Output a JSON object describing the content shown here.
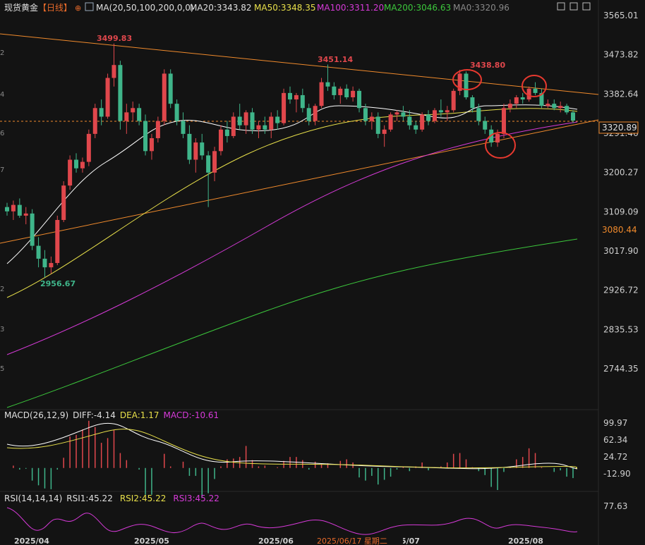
{
  "header": {
    "symbol": "现货黄金",
    "period": "【日线】",
    "ma_spec": "MA(20,50,100,200,0,0)",
    "ma20": "MA20:3343.82",
    "ma50": "MA50:3348.35",
    "ma100": "MA100:3311.20",
    "ma200": "MA200:3046.63",
    "ma0": "MA0:3320.96"
  },
  "price_axis": {
    "ticks": [
      "3565.01",
      "3473.82",
      "3382.64",
      "3291.46",
      "3200.27",
      "3109.09",
      "3017.90",
      "2926.72",
      "2835.53",
      "2744.35"
    ],
    "current_price": "3320.89",
    "ma200_tag": "3080.44"
  },
  "annotations": {
    "high1": "3499.83",
    "high2": "3451.14",
    "high3": "3438.80",
    "low1": "2956.67"
  },
  "macd": {
    "title": "MACD(26,12,9)",
    "diff": "DIFF:-4.14",
    "dea": "DEA:1.17",
    "macd": "MACD:-10.61",
    "ticks": [
      "99.97",
      "62.34",
      "24.72",
      "-12.90"
    ]
  },
  "rsi": {
    "title": "RSI(14,14,14)",
    "rsi1": "RSI1:45.22",
    "rsi2": "RSI2:45.22",
    "rsi3": "RSI3:45.22",
    "tick": "77.63"
  },
  "xaxis": {
    "labels": [
      "2025/04",
      "2025/05",
      "2025/06",
      "2025/07",
      "2025/08"
    ],
    "crosshair_date": "2025/06/17 星期二"
  },
  "colors": {
    "up": "#e0474c",
    "down": "#3fb58a",
    "ma20": "#ffffff",
    "ma50": "#e8e04a",
    "ma100": "#d63ad8",
    "ma200": "#3cc83c",
    "trendline": "#f08a2c",
    "circle": "#e8392f"
  },
  "chart_data": {
    "type": "candlestick",
    "title": "现货黄金 【日线】",
    "ylim": [
      2700,
      3580
    ],
    "x_range": [
      "2025/04",
      "2025/08"
    ],
    "indicators": [
      "MA20",
      "MA50",
      "MA100",
      "MA200",
      "MACD(26,12,9)",
      "RSI(14,14,14)"
    ],
    "ma_values": {
      "MA20": 3343.82,
      "MA50": 3348.35,
      "MA100": 3311.2,
      "MA200": 3046.63,
      "MA0": 3320.96
    },
    "marked_values": {
      "high_apr": 3499.83,
      "high_jun": 3451.14,
      "high_jul": 3438.8,
      "low_apr": 2956.67,
      "last": 3320.89
    },
    "macd_values": {
      "DIFF": -4.14,
      "DEA": 1.17,
      "MACD": -10.61
    },
    "rsi_values": {
      "RSI1": 45.22,
      "RSI2": 45.22,
      "RSI3": 45.22
    },
    "candles": [
      [
        3120,
        3130,
        3100,
        3110
      ],
      [
        3110,
        3135,
        3090,
        3125
      ],
      [
        3125,
        3140,
        3095,
        3100
      ],
      [
        3100,
        3120,
        3080,
        3105
      ],
      [
        3105,
        3115,
        3020,
        3030
      ],
      [
        3030,
        3050,
        2980,
        3000
      ],
      [
        3000,
        3020,
        2956.67,
        2980
      ],
      [
        2980,
        3005,
        2965,
        2990
      ],
      [
        2990,
        3100,
        2985,
        3090
      ],
      [
        3090,
        3180,
        3085,
        3170
      ],
      [
        3170,
        3240,
        3160,
        3230
      ],
      [
        3230,
        3245,
        3200,
        3210
      ],
      [
        3210,
        3235,
        3200,
        3225
      ],
      [
        3225,
        3300,
        3215,
        3290
      ],
      [
        3290,
        3360,
        3280,
        3350
      ],
      [
        3350,
        3370,
        3310,
        3330
      ],
      [
        3330,
        3430,
        3325,
        3420
      ],
      [
        3420,
        3499.83,
        3400,
        3450
      ],
      [
        3450,
        3460,
        3300,
        3320
      ],
      [
        3320,
        3360,
        3290,
        3340
      ],
      [
        3340,
        3365,
        3320,
        3350
      ],
      [
        3350,
        3360,
        3310,
        3320
      ],
      [
        3320,
        3335,
        3240,
        3250
      ],
      [
        3250,
        3290,
        3230,
        3280
      ],
      [
        3280,
        3330,
        3270,
        3320
      ],
      [
        3320,
        3440,
        3310,
        3430
      ],
      [
        3430,
        3440,
        3350,
        3360
      ],
      [
        3360,
        3370,
        3310,
        3320
      ],
      [
        3320,
        3340,
        3280,
        3290
      ],
      [
        3290,
        3310,
        3220,
        3230
      ],
      [
        3230,
        3280,
        3200,
        3270
      ],
      [
        3270,
        3290,
        3230,
        3240
      ],
      [
        3240,
        3250,
        3120,
        3200
      ],
      [
        3200,
        3260,
        3180,
        3250
      ],
      [
        3250,
        3310,
        3240,
        3300
      ],
      [
        3300,
        3320,
        3270,
        3285
      ],
      [
        3285,
        3340,
        3280,
        3330
      ],
      [
        3330,
        3360,
        3300,
        3310
      ],
      [
        3310,
        3345,
        3290,
        3340
      ],
      [
        3340,
        3350,
        3290,
        3300
      ],
      [
        3300,
        3320,
        3280,
        3310
      ],
      [
        3310,
        3330,
        3290,
        3300
      ],
      [
        3300,
        3340,
        3280,
        3330
      ],
      [
        3330,
        3345,
        3300,
        3315
      ],
      [
        3315,
        3395,
        3310,
        3385
      ],
      [
        3385,
        3400,
        3360,
        3370
      ],
      [
        3370,
        3385,
        3340,
        3380
      ],
      [
        3380,
        3395,
        3340,
        3350
      ],
      [
        3350,
        3360,
        3310,
        3320
      ],
      [
        3320,
        3360,
        3310,
        3355
      ],
      [
        3355,
        3420,
        3350,
        3410
      ],
      [
        3410,
        3451.14,
        3390,
        3400
      ],
      [
        3400,
        3410,
        3370,
        3380
      ],
      [
        3380,
        3400,
        3360,
        3395
      ],
      [
        3395,
        3405,
        3370,
        3375
      ],
      [
        3375,
        3400,
        3365,
        3390
      ],
      [
        3390,
        3395,
        3340,
        3350
      ],
      [
        3350,
        3360,
        3310,
        3320
      ],
      [
        3320,
        3340,
        3300,
        3330
      ],
      [
        3330,
        3340,
        3280,
        3290
      ],
      [
        3290,
        3310,
        3260,
        3300
      ],
      [
        3300,
        3340,
        3295,
        3335
      ],
      [
        3335,
        3345,
        3320,
        3340
      ],
      [
        3340,
        3355,
        3320,
        3330
      ],
      [
        3330,
        3345,
        3300,
        3310
      ],
      [
        3310,
        3320,
        3290,
        3300
      ],
      [
        3300,
        3340,
        3295,
        3335
      ],
      [
        3335,
        3345,
        3310,
        3320
      ],
      [
        3320,
        3350,
        3315,
        3345
      ],
      [
        3345,
        3370,
        3330,
        3340
      ],
      [
        3340,
        3355,
        3320,
        3345
      ],
      [
        3345,
        3395,
        3340,
        3390
      ],
      [
        3390,
        3438.8,
        3380,
        3430
      ],
      [
        3430,
        3435,
        3370,
        3375
      ],
      [
        3375,
        3380,
        3340,
        3350
      ],
      [
        3350,
        3360,
        3310,
        3320
      ],
      [
        3320,
        3330,
        3290,
        3300
      ],
      [
        3300,
        3310,
        3260,
        3270
      ],
      [
        3270,
        3300,
        3260,
        3290
      ],
      [
        3290,
        3360,
        3280,
        3350
      ],
      [
        3350,
        3370,
        3340,
        3360
      ],
      [
        3360,
        3380,
        3350,
        3375
      ],
      [
        3375,
        3385,
        3360,
        3370
      ],
      [
        3370,
        3400,
        3365,
        3395
      ],
      [
        3395,
        3410,
        3380,
        3385
      ],
      [
        3385,
        3395,
        3350,
        3355
      ],
      [
        3355,
        3370,
        3350,
        3360
      ],
      [
        3360,
        3370,
        3345,
        3350
      ],
      [
        3350,
        3365,
        3340,
        3355
      ],
      [
        3355,
        3360,
        3335,
        3340
      ],
      [
        3340,
        3345,
        3315,
        3320.89
      ]
    ]
  }
}
